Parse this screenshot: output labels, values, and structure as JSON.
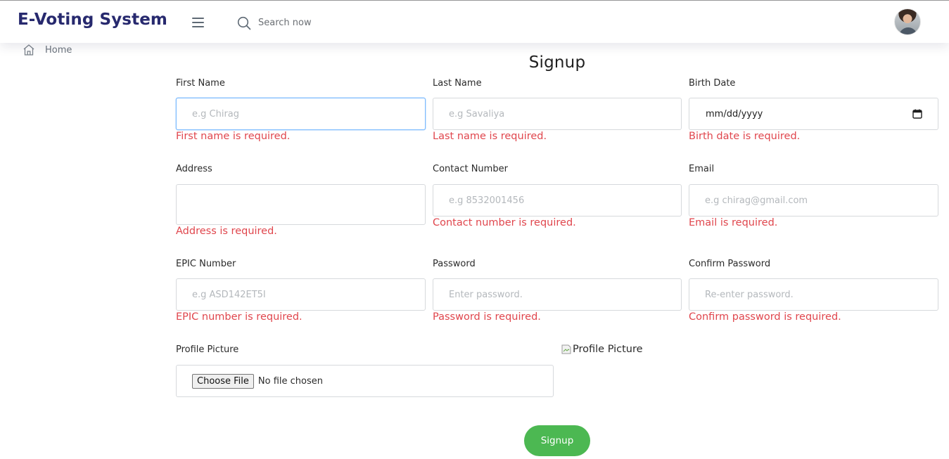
{
  "header": {
    "brand": "E-Voting System",
    "search_placeholder": "Search now"
  },
  "breadcrumb": {
    "home_label": "Home"
  },
  "form": {
    "title": "Signup",
    "first_name": {
      "label": "First Name",
      "placeholder": "e.g Chirag",
      "error": "First name is required."
    },
    "last_name": {
      "label": "Last Name",
      "placeholder": "e.g Savaliya",
      "error": "Last name is required."
    },
    "birth_date": {
      "label": "Birth Date",
      "value_format": "mm/dd/yyyy",
      "error": "Birth date is required."
    },
    "address": {
      "label": "Address",
      "placeholder": "",
      "error": "Address is required."
    },
    "contact_number": {
      "label": "Contact Number",
      "placeholder": "e.g 8532001456",
      "error": "Contact number is required."
    },
    "email": {
      "label": "Email",
      "placeholder": "e.g chirag@gmail.com",
      "error": "Email is required."
    },
    "epic_number": {
      "label": "EPIC Number",
      "placeholder": "e.g ASD142ET5I",
      "error": "EPIC number is required."
    },
    "password": {
      "label": "Password",
      "placeholder": "Enter password.",
      "error": "Password is required."
    },
    "confirm_password": {
      "label": "Confirm Password",
      "placeholder": "Re-enter password.",
      "error": "Confirm password is required."
    },
    "profile_picture": {
      "label": "Profile Picture",
      "button_label": "Choose File",
      "status": "No file chosen",
      "preview_alt": "Profile Picture"
    },
    "submit_label": "Signup"
  },
  "colors": {
    "brand": "#27296e",
    "error": "#e0464d",
    "submit": "#4cb852",
    "focus_border": "#80bdff"
  },
  "icons": [
    "menu-icon",
    "search-icon",
    "home-icon",
    "calendar-icon",
    "broken-image-icon"
  ]
}
